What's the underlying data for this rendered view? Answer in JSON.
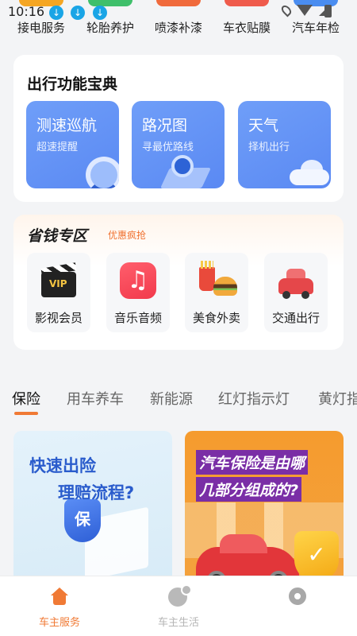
{
  "status_bar": {
    "time": "10:16"
  },
  "top_services": [
    {
      "label": "接电服务",
      "color": "#f5a623"
    },
    {
      "label": "轮胎养护",
      "color": "#3fbf6b"
    },
    {
      "label": "喷漆补漆",
      "color": "#f06a3c"
    },
    {
      "label": "车衣贴膜",
      "color": "#ef5b4c"
    },
    {
      "label": "汽车年检",
      "color": "#4a8df0"
    }
  ],
  "guide": {
    "title": "出行功能宝典",
    "features": [
      {
        "title": "测速巡航",
        "subtitle": "超速提醒",
        "icon": "speedometer-icon"
      },
      {
        "title": "路况图",
        "subtitle": "寻最优路线",
        "icon": "map-pin-icon"
      },
      {
        "title": "天气",
        "subtitle": "择机出行",
        "icon": "cloud-icon"
      }
    ]
  },
  "savings": {
    "title": "省钱专区",
    "tag": "优惠疯抢",
    "items": [
      {
        "label": "影视会员",
        "icon": "clapperboard-icon",
        "icon_text": "VIP"
      },
      {
        "label": "音乐音频",
        "icon": "music-note-icon",
        "icon_text": "♫"
      },
      {
        "label": "美食外卖",
        "icon": "burger-fries-icon"
      },
      {
        "label": "交通出行",
        "icon": "car-icon"
      }
    ]
  },
  "tabs": {
    "items": [
      "保险",
      "用车养车",
      "新能源",
      "红灯指示灯",
      "黄灯指"
    ],
    "active": "保险",
    "indicator_color": "#f07a35"
  },
  "articles": [
    {
      "line1": "快速出险",
      "line2": "理赔流程?",
      "icon": "shield-icon",
      "icon_text": "保"
    },
    {
      "line1": "汽车保险是由哪",
      "line2": "几部分组成的?",
      "icon": "check-badge-icon",
      "icon_text": "✓"
    }
  ],
  "bottom_nav": {
    "items": [
      {
        "label": "车主服务",
        "icon": "home-icon",
        "active": true
      },
      {
        "label": "车主生活",
        "icon": "location-bubble-icon",
        "active": false
      },
      {
        "label": "",
        "icon": "gear-icon",
        "active": false
      }
    ],
    "active_color": "#f07a35",
    "inactive_color": "#b5b5b5"
  }
}
